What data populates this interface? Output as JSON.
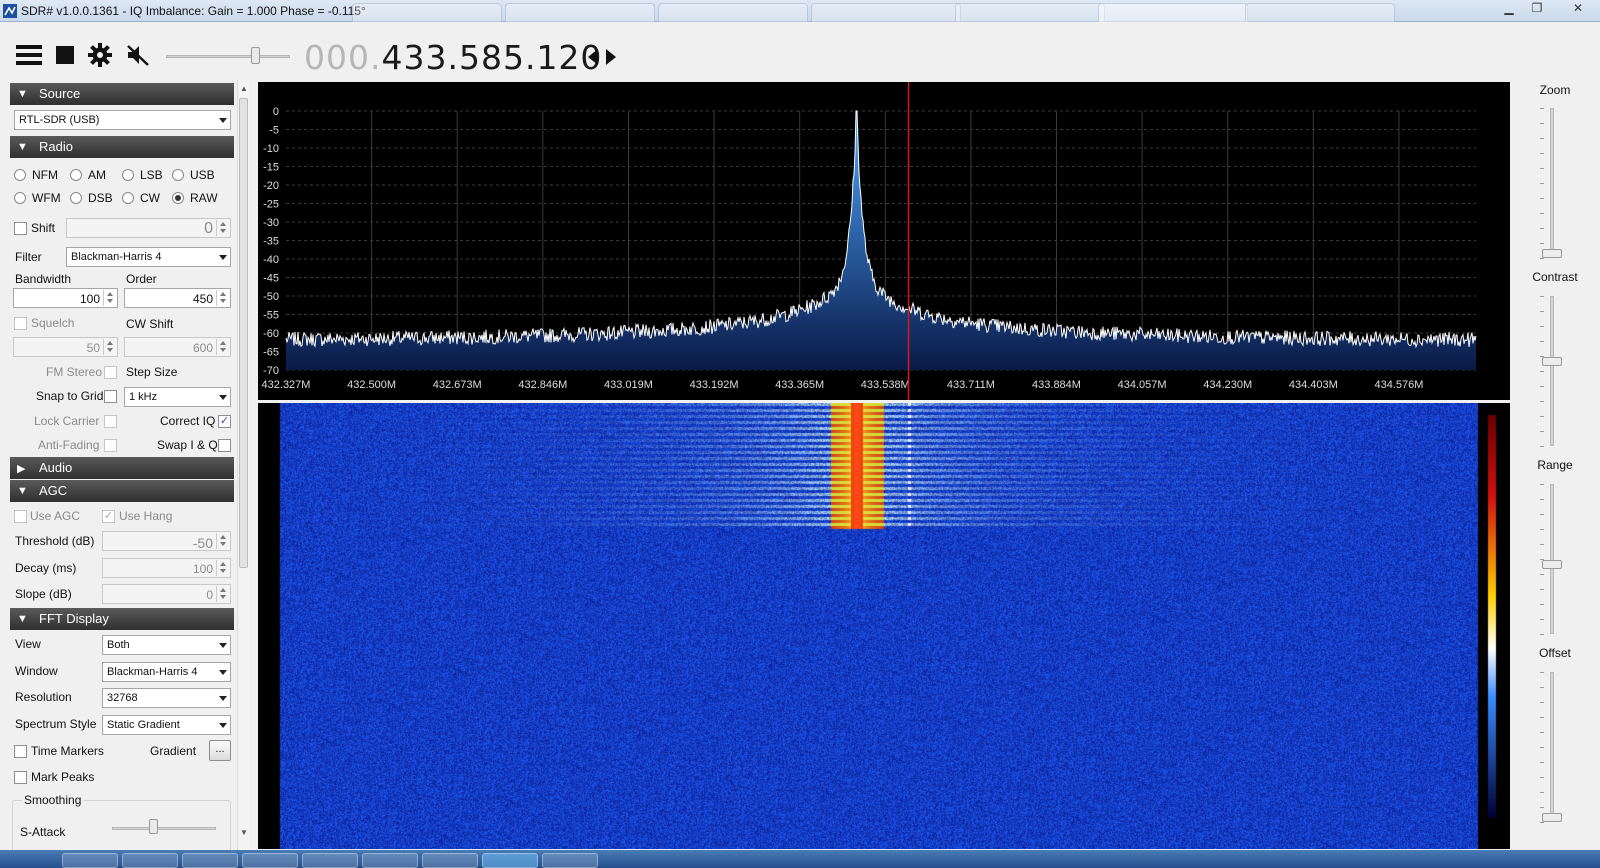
{
  "window": {
    "title": "SDR# v1.0.0.1361 - IQ Imbalance: Gain = 1.000 Phase = -0.115°",
    "controls": [
      "minimize-icon",
      "restore-icon",
      "close-icon"
    ],
    "control_glyphs": {
      "minimize": "▁",
      "restore": "❐",
      "close": "✕"
    }
  },
  "toolbar": {
    "icons": [
      "menu-icon",
      "stop-icon",
      "gear-icon",
      "speaker-muted-icon"
    ],
    "volume_level": 0.72,
    "frequency_dim": "000.",
    "frequency_lit": "433.585.120",
    "tuning_icon": "tune-arrows-icon"
  },
  "source": {
    "header": "Source",
    "device": "RTL-SDR (USB)"
  },
  "radio": {
    "header": "Radio",
    "modes": [
      {
        "label": "NFM",
        "selected": false
      },
      {
        "label": "AM",
        "selected": false
      },
      {
        "label": "LSB",
        "selected": false
      },
      {
        "label": "USB",
        "selected": false
      },
      {
        "label": "WFM",
        "selected": false
      },
      {
        "label": "DSB",
        "selected": false
      },
      {
        "label": "CW",
        "selected": false
      },
      {
        "label": "RAW",
        "selected": true
      }
    ],
    "shift_label": "Shift",
    "shift_value": "0",
    "filter_label": "Filter",
    "filter_value": "Blackman-Harris 4",
    "bandwidth_label": "Bandwidth",
    "bandwidth_value": "100",
    "order_label": "Order",
    "order_value": "450",
    "squelch_label": "Squelch",
    "squelch_value": "50",
    "cw_shift_label": "CW Shift",
    "cw_shift_value": "600",
    "fm_stereo_label": "FM Stereo",
    "step_size_label": "Step Size",
    "snap_label": "Snap to Grid",
    "step_value": "1 kHz",
    "lock_carrier_label": "Lock Carrier",
    "correct_iq_label": "Correct IQ",
    "correct_iq_checked": true,
    "anti_fading_label": "Anti-Fading",
    "swap_iq_label": "Swap I & Q"
  },
  "audio": {
    "header": "Audio"
  },
  "agc": {
    "header": "AGC",
    "use_agc_label": "Use AGC",
    "use_hang_label": "Use Hang",
    "use_hang_checked": true,
    "threshold_label": "Threshold (dB)",
    "threshold_value": "-50",
    "decay_label": "Decay (ms)",
    "decay_value": "100",
    "slope_label": "Slope (dB)",
    "slope_value": "0"
  },
  "fft": {
    "header": "FFT Display",
    "view_label": "View",
    "view_value": "Both",
    "window_label": "Window",
    "window_value": "Blackman-Harris 4",
    "resolution_label": "Resolution",
    "resolution_value": "32768",
    "style_label": "Spectrum Style",
    "style_value": "Static Gradient",
    "time_markers_label": "Time Markers",
    "gradient_label": "Gradient",
    "gradient_button": "...",
    "mark_peaks_label": "Mark Peaks",
    "smoothing_label": "Smoothing",
    "s_attack_label": "S-Attack"
  },
  "right_panel": {
    "zoom_label": "Zoom",
    "contrast_label": "Contrast",
    "range_label": "Range",
    "offset_label": "Offset",
    "zoom_level": 0.0,
    "contrast_level": 0.57,
    "range_level": 0.46,
    "offset_level": 0.0
  },
  "colors": {
    "spectrum_bg": "#000000",
    "grid": "#3a3a3a",
    "trace": "#ffffff",
    "fill_top": "#4aa6ff",
    "fill_bottom": "#0a1a48",
    "tuning_line": "#d21a1a",
    "waterfall_base": "#0b1aa8"
  },
  "spectrum": {
    "y_ticks": [
      "0",
      "-5",
      "-10",
      "-15",
      "-20",
      "-25",
      "-30",
      "-35",
      "-40",
      "-45",
      "-50",
      "-55",
      "-60",
      "-65",
      "-70"
    ],
    "x_ticks": [
      "432.327M",
      "432.500M",
      "432.673M",
      "432.846M",
      "433.019M",
      "433.192M",
      "433.365M",
      "433.538M",
      "433.711M",
      "433.884M",
      "434.057M",
      "434.230M",
      "434.403M",
      "434.576M"
    ],
    "peak_freq_mhz": 433.48,
    "tuned_freq_mhz": 433.585,
    "noise_floor_db": -62,
    "peak_db": 0
  }
}
